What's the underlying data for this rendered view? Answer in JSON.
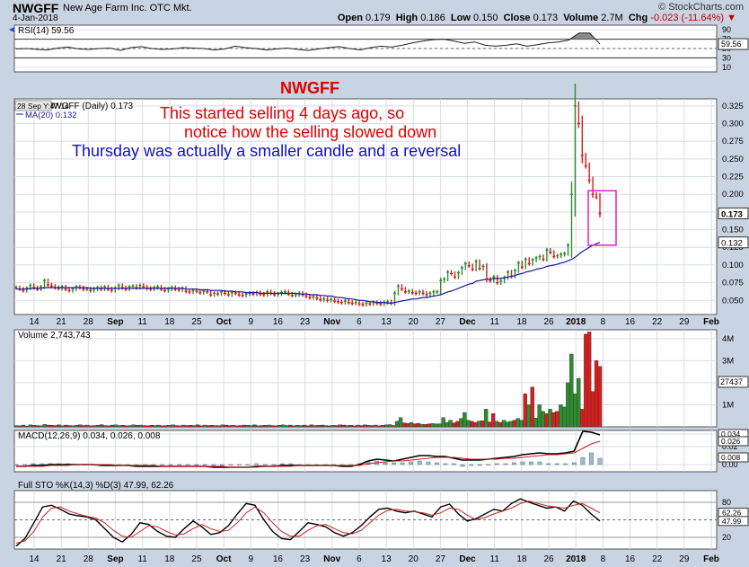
{
  "header": {
    "symbol": "NWGFF",
    "name": "New Age Farm Inc. OTC Mkt.",
    "date": "4-Jan-2018",
    "brand": "© StockCharts.com",
    "open_label": "Open",
    "open": "0.179",
    "high_label": "High",
    "high": "0.186",
    "low_label": "Low",
    "low": "0.150",
    "close_label": "Close",
    "close": "0.173",
    "volume_label": "Volume",
    "volume": "2.7M",
    "chg_label": "Chg",
    "chg": "-0.023 (-11.64%)"
  },
  "annotations": {
    "ticker": "NWGFF",
    "line1": "This started selling 4 days ago,  so",
    "line2": "notice how the selling slowed down",
    "line3": "Thursday was actually a smaller candle and a reversal"
  },
  "colors": {
    "up": "#2e8b2e",
    "down": "#d81e1e",
    "ma": "#1a1aa0",
    "annotation_red": "#e00000",
    "annotation_blue": "#1010c0",
    "box": "#e020c0"
  },
  "x_axis": [
    "14",
    "21",
    "28",
    "Sep",
    "11",
    "18",
    "25",
    "Oct",
    "9",
    "16",
    "23",
    "Nov",
    "6",
    "13",
    "20",
    "27",
    "Dec",
    "11",
    "18",
    "26",
    "2018",
    "8",
    "16",
    "22",
    "29",
    "Feb"
  ],
  "chart_data": [
    {
      "type": "line",
      "title": "RSI(14) 59.56",
      "value": 59.56,
      "ylim": [
        0,
        100
      ],
      "y_ticks": [
        "90",
        "70",
        "50",
        "30",
        "10"
      ],
      "overbought": 70,
      "oversold": 30,
      "series": [
        {
          "values": [
            49,
            50,
            48,
            47,
            51,
            53,
            49,
            48,
            50,
            51,
            46,
            52,
            54,
            50,
            48,
            49,
            52,
            51,
            50,
            47,
            49,
            55,
            52,
            50,
            47,
            49,
            51,
            48,
            46,
            49,
            52,
            54,
            50,
            47,
            52,
            55,
            53,
            57,
            62,
            66,
            69,
            70,
            66,
            61,
            64,
            57,
            55,
            57,
            60,
            55,
            58,
            62,
            64,
            68,
            83,
            83,
            60
          ]
        }
      ]
    },
    {
      "type": "candlestick",
      "title": "NWGFF (Daily) 0.173",
      "inset_label": "28 Sep Y:47.14",
      "ma_label": "MA(20) 0.132",
      "last_price": 0.173,
      "ma_value": 0.132,
      "ylim": [
        0.03,
        0.335
      ],
      "y_ticks": [
        "0.325",
        "0.300",
        "0.275",
        "0.250",
        "0.225",
        "0.200",
        "0.175",
        "0.150",
        "0.125",
        "0.100",
        "0.075",
        "0.050"
      ],
      "close": [
        0.068,
        0.066,
        0.064,
        0.067,
        0.071,
        0.068,
        0.066,
        0.069,
        0.078,
        0.072,
        0.07,
        0.068,
        0.067,
        0.069,
        0.066,
        0.064,
        0.066,
        0.069,
        0.068,
        0.066,
        0.066,
        0.064,
        0.066,
        0.068,
        0.066,
        0.069,
        0.066,
        0.064,
        0.067,
        0.071,
        0.068,
        0.066,
        0.069,
        0.07,
        0.068,
        0.071,
        0.069,
        0.067,
        0.066,
        0.068,
        0.069,
        0.066,
        0.064,
        0.066,
        0.068,
        0.066,
        0.065,
        0.067,
        0.063,
        0.062,
        0.064,
        0.063,
        0.061,
        0.063,
        0.062,
        0.058,
        0.06,
        0.059,
        0.062,
        0.06,
        0.058,
        0.061,
        0.06,
        0.058,
        0.057,
        0.059,
        0.06,
        0.059,
        0.061,
        0.059,
        0.058,
        0.062,
        0.06,
        0.058,
        0.059,
        0.061,
        0.062,
        0.059,
        0.057,
        0.058,
        0.06,
        0.058,
        0.056,
        0.054,
        0.055,
        0.053,
        0.051,
        0.052,
        0.05,
        0.051,
        0.049,
        0.048,
        0.047,
        0.049,
        0.047,
        0.046,
        0.047,
        0.045,
        0.044,
        0.046,
        0.045,
        0.047,
        0.046,
        0.045,
        0.047,
        0.048,
        0.046,
        0.06,
        0.07,
        0.066,
        0.062,
        0.063,
        0.061,
        0.06,
        0.062,
        0.06,
        0.058,
        0.06,
        0.062,
        0.062,
        0.078,
        0.08,
        0.09,
        0.088,
        0.083,
        0.089,
        0.096,
        0.102,
        0.099,
        0.094,
        0.105,
        0.095,
        0.098,
        0.08,
        0.078,
        0.083,
        0.075,
        0.077,
        0.082,
        0.09,
        0.084,
        0.092,
        0.103,
        0.097,
        0.108,
        0.102,
        0.107,
        0.11,
        0.112,
        0.108,
        0.121,
        0.118,
        0.112,
        0.113,
        0.115,
        0.116,
        0.128,
        0.2,
        0.325,
        0.3,
        0.255,
        0.24,
        0.22,
        0.2,
        0.196,
        0.173
      ],
      "ma": [
        0.066,
        0.066,
        0.066,
        0.066,
        0.067,
        0.067,
        0.067,
        0.067,
        0.068,
        0.068,
        0.068,
        0.068,
        0.068,
        0.068,
        0.068,
        0.068,
        0.068,
        0.068,
        0.068,
        0.068,
        0.068,
        0.067,
        0.067,
        0.067,
        0.067,
        0.067,
        0.067,
        0.067,
        0.067,
        0.067,
        0.067,
        0.067,
        0.067,
        0.067,
        0.067,
        0.067,
        0.067,
        0.067,
        0.067,
        0.067,
        0.067,
        0.067,
        0.067,
        0.067,
        0.067,
        0.067,
        0.067,
        0.067,
        0.066,
        0.066,
        0.066,
        0.066,
        0.065,
        0.065,
        0.065,
        0.064,
        0.064,
        0.064,
        0.064,
        0.063,
        0.063,
        0.063,
        0.062,
        0.062,
        0.062,
        0.061,
        0.061,
        0.061,
        0.061,
        0.06,
        0.06,
        0.06,
        0.06,
        0.06,
        0.06,
        0.06,
        0.06,
        0.06,
        0.06,
        0.06,
        0.059,
        0.059,
        0.059,
        0.058,
        0.058,
        0.058,
        0.057,
        0.057,
        0.056,
        0.056,
        0.055,
        0.054,
        0.054,
        0.053,
        0.052,
        0.052,
        0.051,
        0.05,
        0.05,
        0.049,
        0.048,
        0.048,
        0.047,
        0.047,
        0.047,
        0.046,
        0.046,
        0.047,
        0.048,
        0.049,
        0.05,
        0.051,
        0.052,
        0.052,
        0.053,
        0.054,
        0.054,
        0.055,
        0.056,
        0.057,
        0.058,
        0.06,
        0.062,
        0.063,
        0.065,
        0.067,
        0.069,
        0.071,
        0.073,
        0.074,
        0.077,
        0.078,
        0.079,
        0.08,
        0.08,
        0.081,
        0.081,
        0.081,
        0.082,
        0.083,
        0.084,
        0.085,
        0.087,
        0.088,
        0.09,
        0.091,
        0.092,
        0.094,
        0.095,
        0.096,
        0.098,
        0.099,
        0.1,
        0.101,
        0.103,
        0.104,
        0.106,
        0.108,
        0.111,
        0.115,
        0.119,
        0.122,
        0.125,
        0.128,
        0.13,
        0.132
      ]
    },
    {
      "type": "bar",
      "title": "Volume 2,743,743",
      "value_label": "27437",
      "ylim": [
        0,
        4400000
      ],
      "y_ticks": [
        "4M",
        "3M",
        "2M",
        "1M"
      ],
      "values": [
        60000,
        50000,
        80000,
        40000,
        90000,
        70000,
        60000,
        50000,
        110000,
        80000,
        70000,
        60000,
        90000,
        50000,
        80000,
        60000,
        50000,
        70000,
        90000,
        60000,
        80000,
        50000,
        60000,
        70000,
        100000,
        60000,
        50000,
        80000,
        90000,
        60000,
        70000,
        50000,
        60000,
        90000,
        70000,
        80000,
        60000,
        50000,
        70000,
        60000,
        80000,
        50000,
        60000,
        70000,
        90000,
        60000,
        50000,
        80000,
        60000,
        70000,
        60000,
        90000,
        50000,
        80000,
        60000,
        70000,
        60000,
        50000,
        90000,
        80000,
        60000,
        70000,
        50000,
        60000,
        80000,
        70000,
        60000,
        90000,
        50000,
        60000,
        70000,
        80000,
        60000,
        50000,
        70000,
        90000,
        60000,
        80000,
        50000,
        70000,
        60000,
        80000,
        50000,
        90000,
        60000,
        70000,
        80000,
        60000,
        50000,
        70000,
        60000,
        90000,
        80000,
        60000,
        70000,
        50000,
        80000,
        60000,
        90000,
        70000,
        60000,
        80000,
        50000,
        70000,
        90000,
        100000,
        60000,
        250000,
        420000,
        180000,
        150000,
        200000,
        140000,
        160000,
        120000,
        110000,
        130000,
        150000,
        130000,
        140000,
        420000,
        200000,
        300000,
        180000,
        250000,
        380000,
        650000,
        300000,
        250000,
        200000,
        260000,
        280000,
        800000,
        220000,
        600000,
        250000,
        200000,
        300000,
        220000,
        250000,
        300000,
        380000,
        300000,
        1500000,
        1000000,
        1800000,
        400000,
        1000000,
        700000,
        600000,
        800000,
        650000,
        700000,
        1000000,
        900000,
        2000000,
        3300000,
        1500000,
        2200000,
        800000,
        4200000,
        4300000,
        1600000,
        3000000,
        2744000
      ]
    },
    {
      "type": "line",
      "title": "MACD(12,26,9) 0.034, 0.026, 0.008",
      "ylim": [
        -0.008,
        0.038
      ],
      "y_ticks": [
        "0.034",
        "0.02",
        "0.00"
      ],
      "series": [
        {
          "values": [
            -0.002,
            -0.002,
            -0.001,
            -0.001,
            0.0,
            0.0,
            0.0,
            0.0,
            0.0,
            0.0,
            -0.001,
            -0.001,
            -0.001,
            -0.001,
            -0.002,
            -0.002,
            -0.002,
            -0.002,
            -0.002,
            -0.002,
            -0.002,
            -0.002,
            -0.002,
            -0.003,
            -0.003,
            -0.003,
            -0.003,
            -0.003,
            -0.002,
            -0.002,
            -0.002,
            -0.001,
            -0.001,
            -0.001,
            -0.001,
            -0.001,
            -0.001,
            -0.001,
            -0.002,
            -0.002,
            0.0,
            0.004,
            0.006,
            0.005,
            0.004,
            0.006,
            0.008,
            0.01,
            0.01,
            0.009,
            0.009,
            0.007,
            0.005,
            0.005,
            0.005,
            0.006,
            0.007,
            0.008,
            0.009,
            0.011,
            0.012,
            0.013,
            0.012,
            0.012,
            0.013,
            0.015,
            0.037,
            0.036,
            0.033
          ]
        },
        {
          "values": [
            -0.002,
            -0.002,
            -0.002,
            -0.002,
            -0.001,
            -0.001,
            -0.001,
            0.0,
            0.0,
            0.0,
            0.0,
            0.0,
            -0.001,
            -0.001,
            -0.001,
            -0.001,
            -0.001,
            -0.002,
            -0.002,
            -0.002,
            -0.002,
            -0.002,
            -0.002,
            -0.002,
            -0.002,
            -0.003,
            -0.003,
            -0.003,
            -0.003,
            -0.002,
            -0.002,
            -0.002,
            -0.002,
            -0.001,
            -0.001,
            -0.001,
            -0.001,
            -0.001,
            -0.001,
            -0.001,
            -0.001,
            0.001,
            0.002,
            0.003,
            0.004,
            0.004,
            0.005,
            0.006,
            0.007,
            0.008,
            0.008,
            0.008,
            0.007,
            0.006,
            0.006,
            0.006,
            0.006,
            0.007,
            0.007,
            0.008,
            0.009,
            0.01,
            0.011,
            0.011,
            0.012,
            0.013,
            0.018,
            0.023,
            0.026
          ]
        }
      ],
      "histogram": [
        0.0,
        0.0,
        0.001,
        0.001,
        0.001,
        0.001,
        0.001,
        0.0,
        0.0,
        0.0,
        -0.001,
        -0.001,
        0.0,
        0.0,
        -0.001,
        -0.001,
        -0.001,
        0.0,
        0.0,
        0.0,
        0.0,
        0.0,
        0.0,
        -0.001,
        -0.001,
        0.0,
        0.0,
        0.0,
        0.001,
        0.0,
        0.0,
        0.001,
        0.001,
        0.0,
        0.0,
        0.0,
        0.0,
        0.0,
        -0.001,
        -0.001,
        0.001,
        0.003,
        0.004,
        0.002,
        0.002,
        0.002,
        0.003,
        0.004,
        0.003,
        0.002,
        0.001,
        0.001,
        -0.002,
        -0.001,
        -0.001,
        0.0,
        0.001,
        0.001,
        0.002,
        0.003,
        0.003,
        0.003,
        0.001,
        0.001,
        0.001,
        0.002,
        0.008,
        0.013,
        0.007
      ]
    },
    {
      "type": "line",
      "title": "Full STO %K(14,3) %D(3) 47.99, 62.26",
      "ylim": [
        0,
        100
      ],
      "y_ticks": [
        "80",
        "50",
        "20"
      ],
      "series": [
        {
          "values": [
            5,
            18,
            45,
            72,
            75,
            68,
            60,
            57,
            55,
            50,
            35,
            20,
            12,
            25,
            45,
            42,
            30,
            22,
            20,
            35,
            48,
            38,
            25,
            28,
            40,
            60,
            78,
            75,
            50,
            30,
            18,
            16,
            30,
            45,
            42,
            38,
            28,
            22,
            28,
            40,
            55,
            68,
            70,
            65,
            62,
            65,
            60,
            55,
            72,
            77,
            60,
            48,
            52,
            60,
            68,
            65,
            78,
            86,
            80,
            75,
            70,
            72,
            65,
            82,
            75,
            60,
            48
          ]
        },
        {
          "values": [
            10,
            14,
            30,
            55,
            70,
            72,
            65,
            60,
            56,
            53,
            45,
            32,
            22,
            20,
            30,
            40,
            38,
            30,
            24,
            26,
            35,
            42,
            35,
            30,
            32,
            45,
            62,
            72,
            62,
            45,
            30,
            22,
            22,
            32,
            40,
            42,
            35,
            28,
            26,
            32,
            45,
            58,
            66,
            68,
            65,
            64,
            62,
            58,
            62,
            70,
            68,
            58,
            50,
            54,
            60,
            65,
            70,
            78,
            82,
            78,
            74,
            72,
            70,
            75,
            78,
            70,
            62
          ]
        }
      ]
    }
  ]
}
